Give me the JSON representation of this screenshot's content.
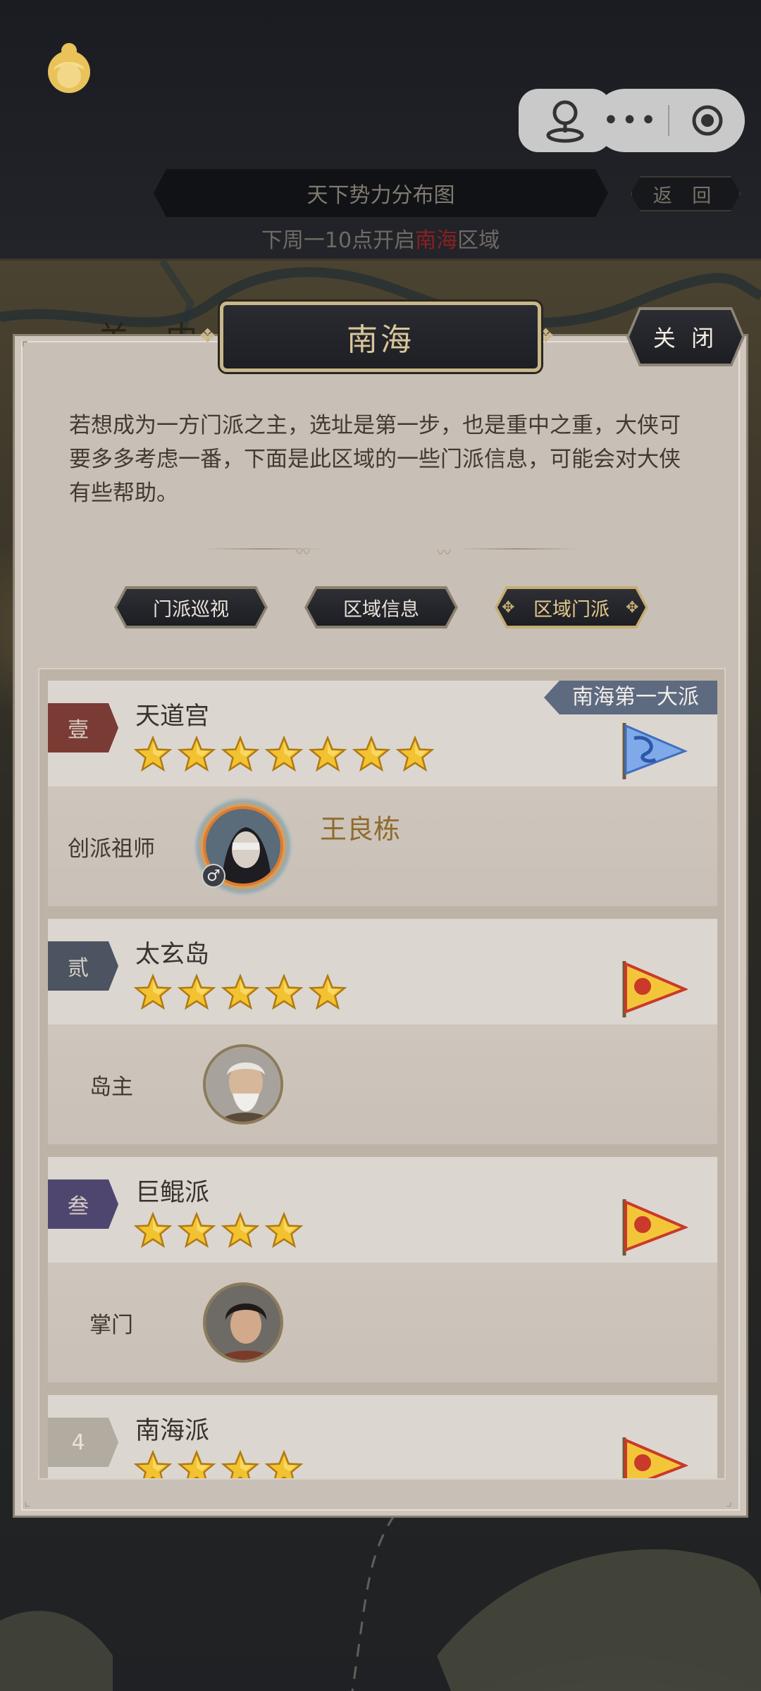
{
  "header": {
    "title": "天下势力分布图",
    "back_label": "返 回",
    "notice_before": "下周一10点开启",
    "notice_highlight": "南海",
    "notice_after": "区域"
  },
  "map": {
    "label": "关 中"
  },
  "panel": {
    "region_title": "南海",
    "close_label": "关 闭",
    "intro": "若想成为一方门派之主，选址是第一步，也是重中之重，大侠可要多多考虑一番，下面是此区域的一些门派信息，可能会对大侠有些帮助。",
    "tabs": [
      {
        "label": "门派巡视",
        "active": false
      },
      {
        "label": "区域信息",
        "active": false
      },
      {
        "label": "区域门派",
        "active": true
      }
    ]
  },
  "sects": [
    {
      "rank": "壹",
      "rank_color": "#7a3b34",
      "name": "天道宫",
      "stars": 7,
      "badge": "南海第一大派",
      "flag": "blue-dragon-flag",
      "role": "创派祖师",
      "founder_name": "王良栋",
      "gender": "♂"
    },
    {
      "rank": "贰",
      "rank_color": "#4c5461",
      "name": "太玄岛",
      "stars": 5,
      "flag": "yellow-flag",
      "role": "岛主"
    },
    {
      "rank": "叁",
      "rank_color": "#4f4670",
      "name": "巨鲲派",
      "stars": 4,
      "flag": "yellow-flag",
      "role": "掌门"
    },
    {
      "rank": "4",
      "rank_color": "#b2aba0",
      "name": "南海派",
      "stars": 4,
      "flag": "yellow-flag"
    }
  ],
  "colors": {
    "accent_gold": "#c6ad72",
    "highlight_red": "#8a2020",
    "founder_name": "#8f6b2e"
  }
}
